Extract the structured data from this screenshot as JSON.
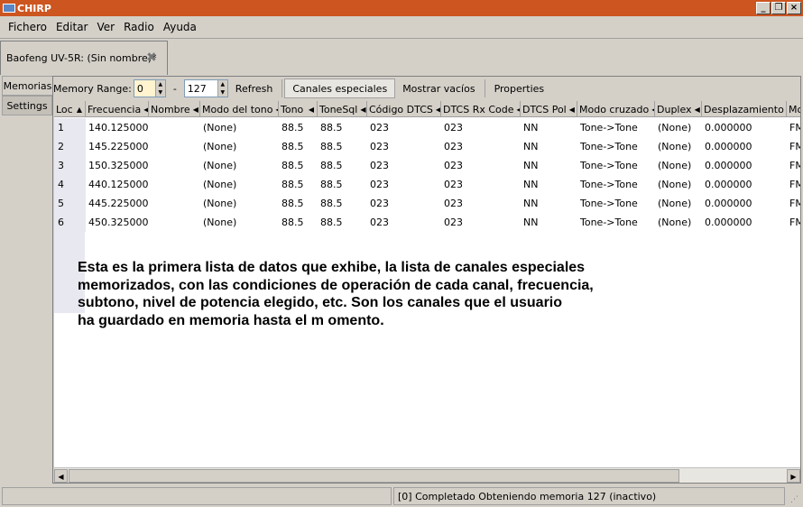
{
  "window": {
    "title": "CHIRP"
  },
  "menu": [
    "Fichero",
    "Editar",
    "Ver",
    "Radio",
    "Ayuda"
  ],
  "doc_tab": {
    "label": "Baofeng UV-5R: (Sin nombre)*"
  },
  "side_tabs": [
    "Memorias",
    "Settings"
  ],
  "toolbar": {
    "range_label": "Memory Range:",
    "range_start": "0",
    "range_end": "127",
    "dash": "-",
    "refresh_label": "Refresh",
    "special_label": "Canales especiales",
    "show_empty_label": "Mostrar vacíos",
    "properties_label": "Properties"
  },
  "table": {
    "columns": [
      "Loc",
      "Frecuencia",
      "Nombre",
      "Modo del tono",
      "Tono",
      "ToneSql",
      "Código DTCS",
      "DTCS Rx Code",
      "DTCS Pol",
      "Modo cruzado",
      "Duplex",
      "Desplazamiento",
      "Mo"
    ],
    "rows": [
      [
        "1",
        "140.125000",
        "",
        "(None)",
        "88.5",
        "88.5",
        "023",
        "023",
        "NN",
        "Tone->Tone",
        "(None)",
        "0.000000",
        "FM"
      ],
      [
        "2",
        "145.225000",
        "",
        "(None)",
        "88.5",
        "88.5",
        "023",
        "023",
        "NN",
        "Tone->Tone",
        "(None)",
        "0.000000",
        "FM"
      ],
      [
        "3",
        "150.325000",
        "",
        "(None)",
        "88.5",
        "88.5",
        "023",
        "023",
        "NN",
        "Tone->Tone",
        "(None)",
        "0.000000",
        "FM"
      ],
      [
        "4",
        "440.125000",
        "",
        "(None)",
        "88.5",
        "88.5",
        "023",
        "023",
        "NN",
        "Tone->Tone",
        "(None)",
        "0.000000",
        "FM"
      ],
      [
        "5",
        "445.225000",
        "",
        "(None)",
        "88.5",
        "88.5",
        "023",
        "023",
        "NN",
        "Tone->Tone",
        "(None)",
        "0.000000",
        "FM"
      ],
      [
        "6",
        "450.325000",
        "",
        "(None)",
        "88.5",
        "88.5",
        "023",
        "023",
        "NN",
        "Tone->Tone",
        "(None)",
        "0.000000",
        "FM"
      ]
    ]
  },
  "annotation": {
    "lines": [
      "Esta es la primera lista de datos que exhibe, la lista de canales especiales",
      "memorizados, con las condiciones de operación de cada canal, frecuencia,",
      "subtono, nivel de potencia elegido, etc. Son los canales que el usuario",
      "ha guardado en memoria hasta el m omento."
    ]
  },
  "status": {
    "left": "",
    "right": "[0] Completado Obteniendo memoria 127 (inactivo)"
  },
  "colors": {
    "titlebar": "#cc5520",
    "window_bg": "#d4d0c8",
    "grid_bg": "#ffffff"
  }
}
